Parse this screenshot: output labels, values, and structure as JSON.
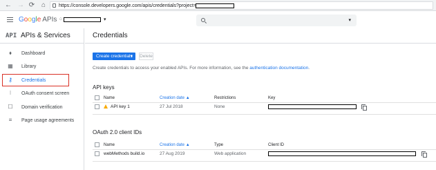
{
  "browser": {
    "back": "←",
    "forward": "→",
    "reload": "⟳",
    "home": "⌂",
    "url": "https://console.developers.google.com/apis/credentials?project="
  },
  "header": {
    "logo_letters": [
      "G",
      "o",
      "o",
      "g",
      "l",
      "e"
    ],
    "logo_suffix": "APIs",
    "project_dots": "⁘",
    "caret": "▾"
  },
  "sidebar": {
    "badge": "API",
    "title": "APIs & Services",
    "items": [
      {
        "label": "Dashboard",
        "icon": "⬧"
      },
      {
        "label": "Library",
        "icon": "▦"
      },
      {
        "label": "Credentials",
        "icon": "⚷"
      },
      {
        "label": "OAuth consent screen",
        "icon": "⁝"
      },
      {
        "label": "Domain verification",
        "icon": "☐"
      },
      {
        "label": "Page usage agreements",
        "icon": "≡"
      }
    ]
  },
  "main": {
    "title": "Credentials",
    "create_label": "Create credentials",
    "create_caret": "▾",
    "delete_label": "Delete",
    "hint_text": "Create credentials to access your enabled APIs. For more information, see the ",
    "hint_link": "authentication documentation",
    "hint_end": "."
  },
  "api_keys": {
    "title": "API keys",
    "columns": {
      "name": "Name",
      "date": "Creation date",
      "sort_arrow": "▲",
      "restrictions": "Restrictions",
      "key": "Key"
    },
    "rows": [
      {
        "name": "API key 1",
        "date": "27 Jul 2018",
        "restrictions": "None"
      }
    ]
  },
  "oauth": {
    "title": "OAuth 2.0 client IDs",
    "columns": {
      "name": "Name",
      "date": "Creation date",
      "sort_arrow": "▲",
      "type": "Type",
      "client_id": "Client ID"
    },
    "rows": [
      {
        "name": "webMethods build.io",
        "date": "27 Aug 2019",
        "type": "Web application"
      }
    ]
  },
  "colors": {
    "accent": "#1a73e8",
    "highlight_box": "#d93025",
    "warning": "#f9ab00"
  }
}
